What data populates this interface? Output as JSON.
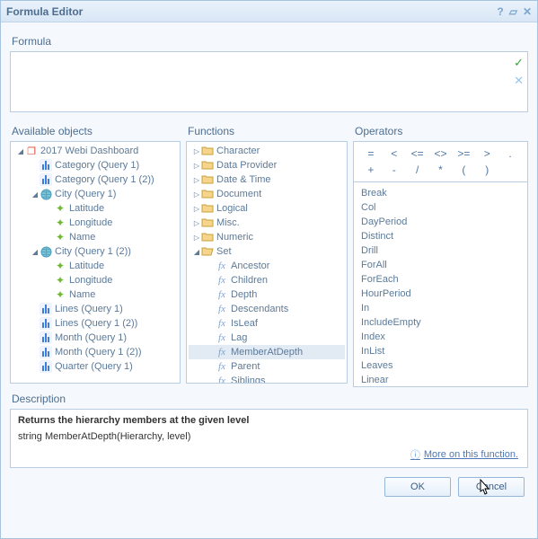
{
  "title": "Formula Editor",
  "labels": {
    "formula": "Formula",
    "available_objects": "Available objects",
    "functions": "Functions",
    "operators": "Operators",
    "description": "Description"
  },
  "formula_value": "",
  "objects_tree": [
    {
      "indent": 0,
      "exp": "▾",
      "icon": "cube",
      "label": "2017 Webi Dashboard"
    },
    {
      "indent": 1,
      "exp": "",
      "icon": "dim",
      "label": "Category (Query 1)"
    },
    {
      "indent": 1,
      "exp": "",
      "icon": "dim",
      "label": "Category (Query 1 (2))"
    },
    {
      "indent": 1,
      "exp": "▾",
      "icon": "globe",
      "label": "City (Query 1)"
    },
    {
      "indent": 2,
      "exp": "",
      "icon": "attr",
      "label": "Latitude"
    },
    {
      "indent": 2,
      "exp": "",
      "icon": "attr",
      "label": "Longitude"
    },
    {
      "indent": 2,
      "exp": "",
      "icon": "attr",
      "label": "Name"
    },
    {
      "indent": 1,
      "exp": "▾",
      "icon": "globe",
      "label": "City (Query 1 (2))"
    },
    {
      "indent": 2,
      "exp": "",
      "icon": "attr",
      "label": "Latitude"
    },
    {
      "indent": 2,
      "exp": "",
      "icon": "attr",
      "label": "Longitude"
    },
    {
      "indent": 2,
      "exp": "",
      "icon": "attr",
      "label": "Name"
    },
    {
      "indent": 1,
      "exp": "",
      "icon": "dim",
      "label": "Lines (Query 1)"
    },
    {
      "indent": 1,
      "exp": "",
      "icon": "dim",
      "label": "Lines (Query 1 (2))"
    },
    {
      "indent": 1,
      "exp": "",
      "icon": "dim",
      "label": "Month (Query 1)"
    },
    {
      "indent": 1,
      "exp": "",
      "icon": "dim",
      "label": "Month (Query 1 (2))"
    },
    {
      "indent": 1,
      "exp": "",
      "icon": "dim",
      "label": "Quarter (Query 1)"
    }
  ],
  "functions_tree": [
    {
      "indent": 0,
      "exp": "▸",
      "icon": "folder",
      "label": "Character"
    },
    {
      "indent": 0,
      "exp": "▸",
      "icon": "folder",
      "label": "Data Provider"
    },
    {
      "indent": 0,
      "exp": "▸",
      "icon": "folder",
      "label": "Date & Time"
    },
    {
      "indent": 0,
      "exp": "▸",
      "icon": "folder",
      "label": "Document"
    },
    {
      "indent": 0,
      "exp": "▸",
      "icon": "folder",
      "label": "Logical"
    },
    {
      "indent": 0,
      "exp": "▸",
      "icon": "folder",
      "label": "Misc."
    },
    {
      "indent": 0,
      "exp": "▸",
      "icon": "folder",
      "label": "Numeric"
    },
    {
      "indent": 0,
      "exp": "▾",
      "icon": "folder-open",
      "label": "Set"
    },
    {
      "indent": 1,
      "exp": "",
      "icon": "fx",
      "label": "Ancestor"
    },
    {
      "indent": 1,
      "exp": "",
      "icon": "fx",
      "label": "Children"
    },
    {
      "indent": 1,
      "exp": "",
      "icon": "fx",
      "label": "Depth"
    },
    {
      "indent": 1,
      "exp": "",
      "icon": "fx",
      "label": "Descendants"
    },
    {
      "indent": 1,
      "exp": "",
      "icon": "fx",
      "label": "IsLeaf"
    },
    {
      "indent": 1,
      "exp": "",
      "icon": "fx",
      "label": "Lag"
    },
    {
      "indent": 1,
      "exp": "",
      "icon": "fx",
      "label": "MemberAtDepth",
      "selected": true
    },
    {
      "indent": 1,
      "exp": "",
      "icon": "fx",
      "label": "Parent"
    },
    {
      "indent": 1,
      "exp": "",
      "icon": "fx",
      "label": "Siblings"
    }
  ],
  "operator_symbols": [
    "=",
    "<",
    "<=",
    "<>",
    ">=",
    ">",
    ".",
    "+",
    "-",
    "/",
    "*",
    "(",
    ")"
  ],
  "operator_words": [
    "Break",
    "Col",
    "DayPeriod",
    "Distinct",
    "Drill",
    "ForAll",
    "ForEach",
    "HourPeriod",
    "In",
    "IncludeEmpty",
    "Index",
    "InList",
    "Leaves",
    "Linear"
  ],
  "description": {
    "title": "Returns the hierarchy members at the given level",
    "prototype": "string MemberAtDepth(Hierarchy, level)",
    "more_link": "More on this function."
  },
  "buttons": {
    "ok": "OK",
    "cancel": "Cancel"
  }
}
